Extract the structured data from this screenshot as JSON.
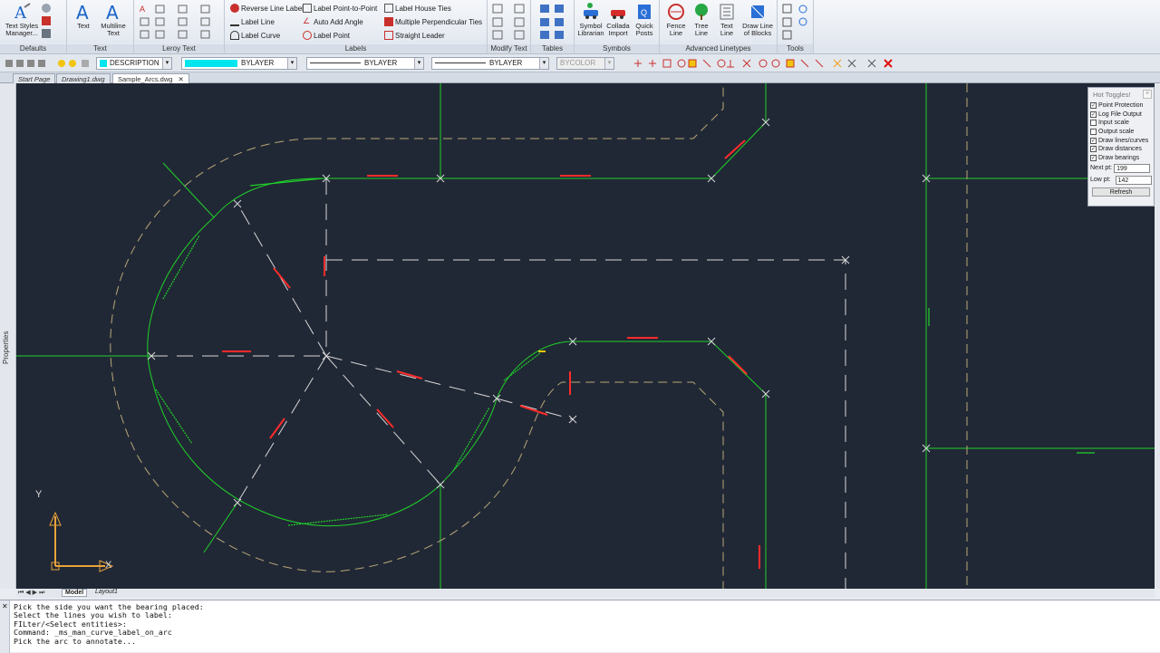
{
  "ribbon": {
    "groups": [
      {
        "title": "Defaults",
        "buttons": [
          {
            "label": "Text Styles Manager..."
          }
        ]
      },
      {
        "title": "Text",
        "buttons": [
          {
            "label": "Text"
          },
          {
            "label": "Multiline Text"
          }
        ]
      },
      {
        "title": "Leroy Text",
        "buttons": []
      },
      {
        "title": "Labels",
        "items": [
          "Reverse Line Label",
          "Label Point-to-Point",
          "Label House Ties",
          "Label Line",
          "Auto Add Angle",
          "Multiple Perpendicular Ties",
          "Label Curve",
          "Label Point",
          "Straight Leader"
        ]
      },
      {
        "title": "Modify Text",
        "buttons": []
      },
      {
        "title": "Tables",
        "buttons": []
      },
      {
        "title": "Symbols",
        "buttons": [
          {
            "label": "Symbol Librarian"
          },
          {
            "label": "Collada Import"
          },
          {
            "label": "Quick Posts"
          }
        ]
      },
      {
        "title": "Advanced Linetypes",
        "buttons": [
          {
            "label": "Fence Line"
          },
          {
            "label": "Tree Line"
          },
          {
            "label": "Text Line"
          },
          {
            "label": "Draw Line of Blocks"
          }
        ]
      },
      {
        "title": "Tools",
        "buttons": []
      }
    ]
  },
  "toolbar": {
    "layer": "DESCRIPTION",
    "color": "BYLAYER",
    "color_swatch": "#00e5ee",
    "linetype": "BYLAYER",
    "lineweight": "BYLAYER",
    "plotstyle": "BYCOLOR"
  },
  "file_tabs": [
    "Start Page",
    "Drawing1.dwg",
    "Sample_Arcs.dwg"
  ],
  "active_tab": "Sample_Arcs.dwg",
  "left_panel_label": "Properties",
  "hot_toggles": {
    "title": "Hot Toggles!",
    "options": [
      {
        "label": "Point Protection",
        "checked": true
      },
      {
        "label": "Log File Output",
        "checked": true
      },
      {
        "label": "Input scale",
        "checked": false
      },
      {
        "label": "Output scale",
        "checked": false
      },
      {
        "label": "Draw lines/curves",
        "checked": true
      },
      {
        "label": "Draw distances",
        "checked": true
      },
      {
        "label": "Draw bearings",
        "checked": true
      }
    ],
    "next_pt_label": "Next pt:",
    "next_pt": "199",
    "low_pt_label": "Low pt:",
    "low_pt": "142",
    "refresh_label": "Refresh"
  },
  "ucs": {
    "x_label": "X",
    "y_label": "Y"
  },
  "layout_tabs": [
    "Model",
    "Layout1"
  ],
  "command_history": [
    "Pick the side you want the bearing placed:",
    "Select the lines you wish to label:",
    "FILter/<Select entities>:",
    "Command: _ms_man_curve_label_on_arc",
    "Pick the arc to annotate..."
  ],
  "colors": {
    "canvas_bg": "#212835",
    "line_green": "#1fd12a",
    "dash_tan": "#b8a878",
    "white_dash": "#d6d6d6",
    "label_red": "#ff2b2b"
  }
}
